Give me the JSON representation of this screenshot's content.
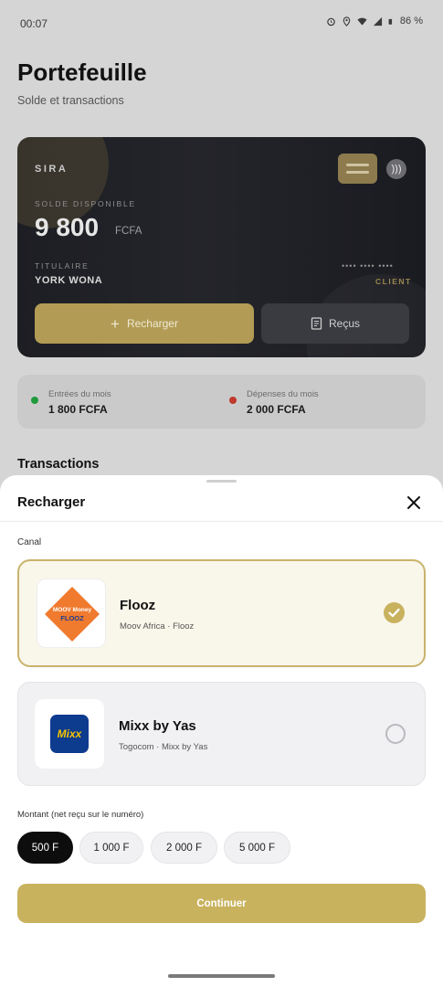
{
  "status_bar": {
    "time": "00:07",
    "battery": "86 %",
    "icons": [
      "alarm-icon",
      "location-icon",
      "wifi-icon",
      "signal-icon",
      "battery-icon"
    ]
  },
  "header": {
    "title": "Portefeuille",
    "subtitle": "Solde et transactions"
  },
  "card": {
    "brand": "SIRA",
    "balance_label": "SOLDE DISPONIBLE",
    "balance": "9 800",
    "currency": "FCFA",
    "holder_label": "TITULAIRE",
    "holder": "YORK WONA",
    "masked_number": "•••• •••• ••••",
    "role": "CLIENT",
    "recharge_label": "Recharger",
    "receipts_label": "Reçus"
  },
  "stats": {
    "income_label": "Entrées du mois",
    "income_value": "1 800 FCFA",
    "expense_label": "Dépenses du mois",
    "expense_value": "2 000 FCFA",
    "colors": {
      "income": "#1f9a3c",
      "expense": "#c0392b"
    }
  },
  "transactions_title": "Transactions",
  "sheet": {
    "title": "Recharger",
    "channel_label": "Canal",
    "channels": [
      {
        "name": "Flooz",
        "subtitle": "Moov Africa · Flooz",
        "selected": true,
        "logo_text": "MOOV Money FLOOZ"
      },
      {
        "name": "Mixx by Yas",
        "subtitle": "Togocom · Mixx by Yas",
        "selected": false,
        "logo_text": "Mixx"
      }
    ],
    "amount_label": "Montant (net reçu sur le numéro)",
    "amounts": [
      {
        "label": "500 F",
        "active": true
      },
      {
        "label": "1 000 F",
        "active": false
      },
      {
        "label": "2 000 F",
        "active": false
      },
      {
        "label": "5 000 F",
        "active": false
      }
    ],
    "continue_label": "Continuer"
  },
  "colors": {
    "accent": "#c9b25e",
    "card_dark": "#1d1e23",
    "flooz_orange": "#f07a2e",
    "mixx_blue": "#0d3b8e",
    "mixx_yellow": "#f5c400"
  }
}
